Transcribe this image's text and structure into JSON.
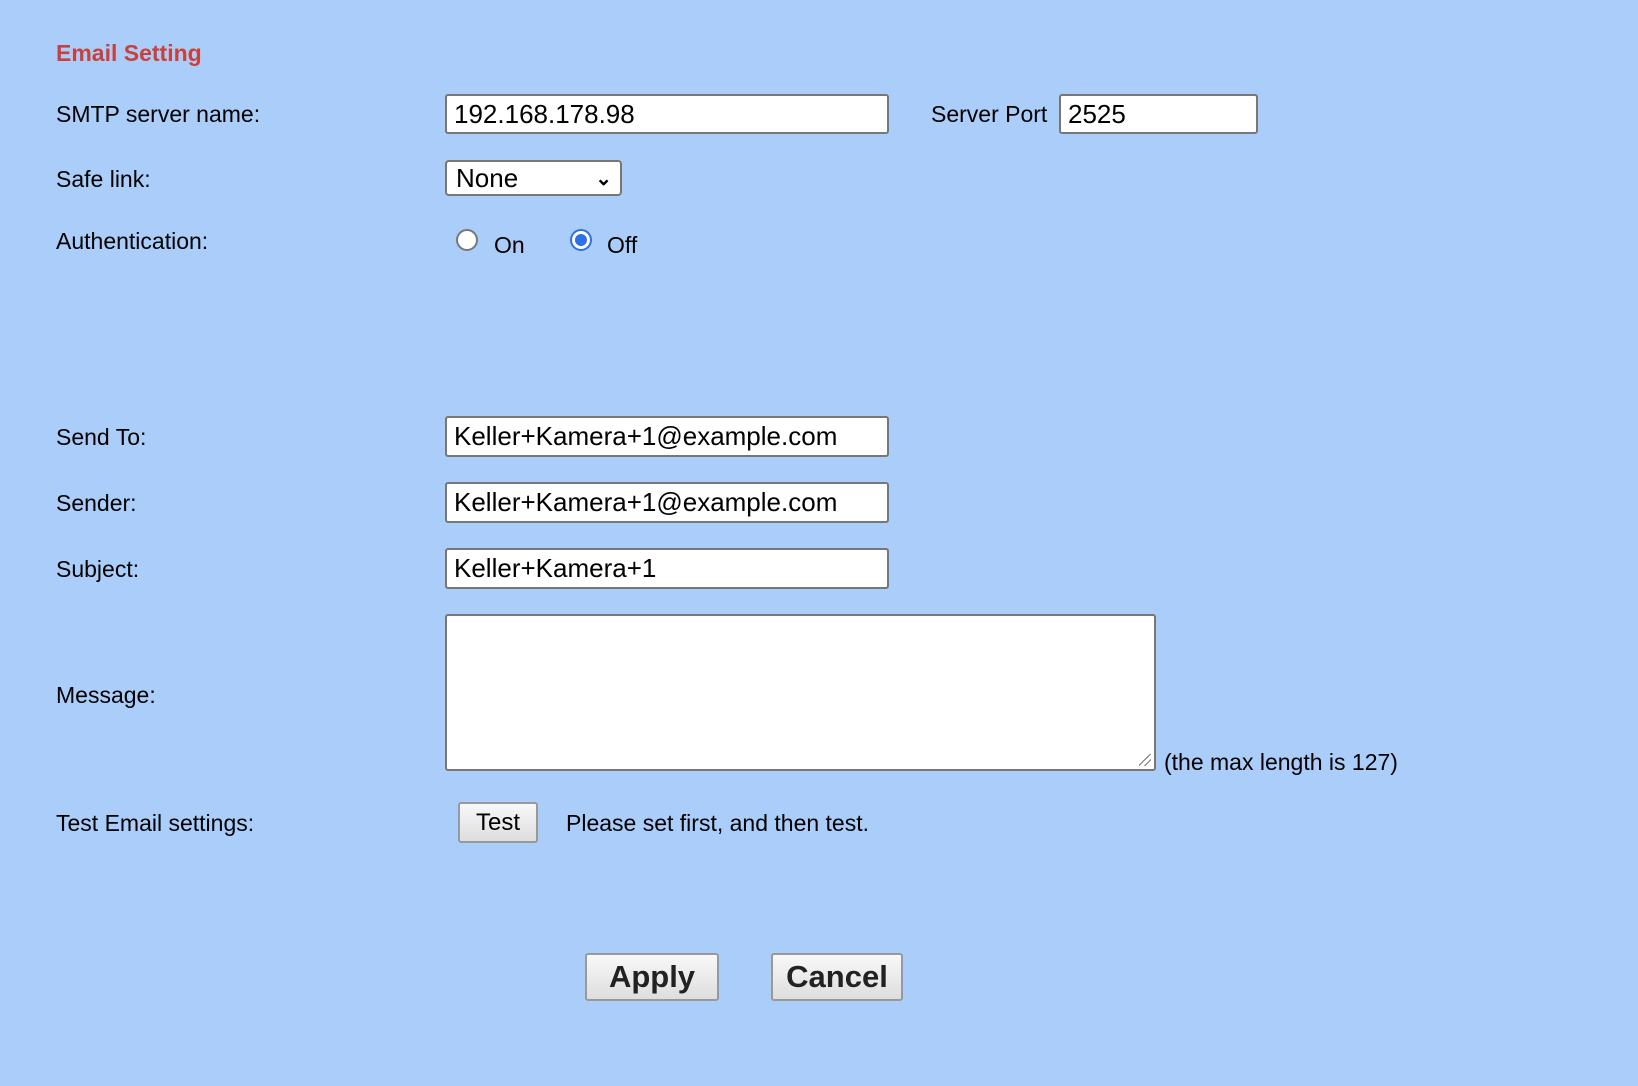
{
  "title": "Email Setting",
  "smtp": {
    "label": "SMTP server name:",
    "value": "192.168.178.98",
    "port_label": "Server Port",
    "port_value": "2525"
  },
  "safe_link": {
    "label": "Safe link:",
    "selected": "None"
  },
  "authentication": {
    "label": "Authentication:",
    "options": [
      "On",
      "Off"
    ],
    "selected": "Off"
  },
  "send_to": {
    "label": "Send To:",
    "value": "Keller+Kamera+1@example.com"
  },
  "sender": {
    "label": "Sender:",
    "value": "Keller+Kamera+1@example.com"
  },
  "subject": {
    "label": "Subject:",
    "value": "Keller+Kamera+1"
  },
  "message": {
    "label": "Message:",
    "value": "",
    "hint": "(the max length is 127)"
  },
  "test": {
    "label": "Test Email settings:",
    "button": "Test",
    "note": "Please set first, and then test."
  },
  "actions": {
    "apply": "Apply",
    "cancel": "Cancel"
  },
  "colors": {
    "background": "#aacdf9",
    "title": "#c9413d",
    "radio_accent": "#2f6fe8"
  }
}
